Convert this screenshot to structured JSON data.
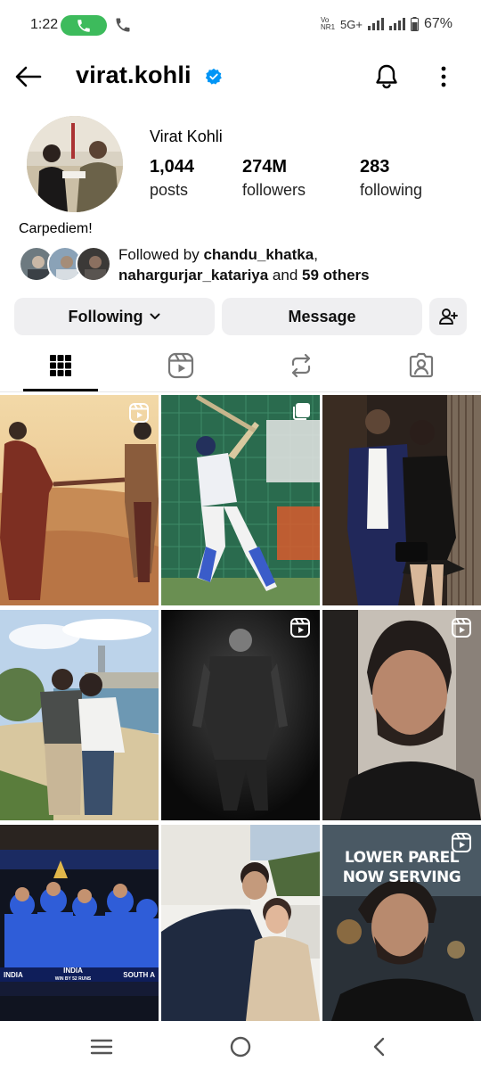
{
  "status_bar": {
    "time": "1:22",
    "network": "5G+",
    "battery": "67%"
  },
  "header": {
    "username": "virat.kohli",
    "verified": true
  },
  "profile": {
    "display_name": "Virat Kohli",
    "stats": [
      {
        "value": "1,044",
        "label": "posts"
      },
      {
        "value": "274M",
        "label": "followers"
      },
      {
        "value": "283",
        "label": "following"
      }
    ],
    "bio": "Carpediem!",
    "followed_by": {
      "prefix": "Followed by ",
      "user1": "chandu_khatka",
      "sep": ",",
      "user2": "nahargurjar_katariya",
      "and": " and ",
      "others": "59 others"
    }
  },
  "actions": {
    "following_label": "Following",
    "message_label": "Message"
  },
  "tabs": [
    "grid-icon",
    "reels-icon",
    "reposts-icon",
    "tagged-icon"
  ],
  "grid_posts": [
    {
      "type": "reel"
    },
    {
      "type": "carousel"
    },
    {
      "type": "photo"
    },
    {
      "type": "photo"
    },
    {
      "type": "reel"
    },
    {
      "type": "reel"
    },
    {
      "type": "photo",
      "caption_text": [
        "INDIA",
        "INDIA",
        "SOUTH A"
      ]
    },
    {
      "type": "photo"
    },
    {
      "type": "reel",
      "overlay_text": "LOWER PAREL NOW SERVING"
    }
  ],
  "overlay": {
    "line1": "LOWER PAREL",
    "line2": "NOW SERVING"
  },
  "tv_caption": {
    "left": "INDIA",
    "center": "INDIA",
    "center_sub": "WIN BY 52 RUNS",
    "right": "SOUTH A"
  },
  "colors": {
    "verified_blue": "#0095f6",
    "button_bg": "#efeff1",
    "call_green": "#3dbb5c"
  }
}
